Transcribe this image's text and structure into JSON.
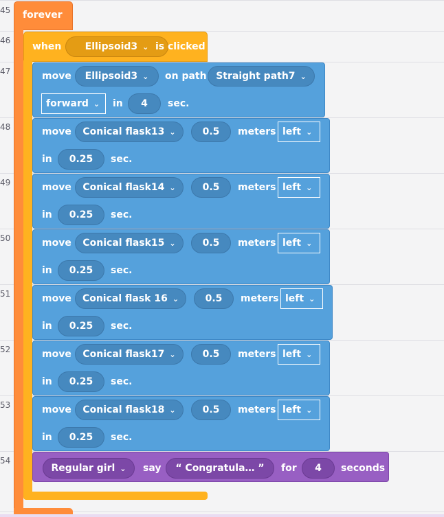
{
  "line_numbers": [
    "45",
    "46",
    "47",
    "48",
    "49",
    "50",
    "51",
    "52",
    "53",
    "54"
  ],
  "forever": {
    "label": "forever"
  },
  "event": {
    "when": "when",
    "object": "Ellipsoid3",
    "suffix": "is clicked"
  },
  "path_move": {
    "move": "move",
    "object": "Ellipsoid3",
    "on_path": "on path",
    "path": "Straight path7",
    "direction": "forward",
    "in": "in",
    "duration": "4",
    "unit": "sec."
  },
  "moves": [
    {
      "move": "move",
      "object": "Conical flask13",
      "distance": "0.5",
      "meters": "meters",
      "direction": "left",
      "in": "in",
      "duration": "0.25",
      "unit": "sec."
    },
    {
      "move": "move",
      "object": "Conical flask14",
      "distance": "0.5",
      "meters": "meters",
      "direction": "left",
      "in": "in",
      "duration": "0.25",
      "unit": "sec."
    },
    {
      "move": "move",
      "object": "Conical flask15",
      "distance": "0.5",
      "meters": "meters",
      "direction": "left",
      "in": "in",
      "duration": "0.25",
      "unit": "sec."
    },
    {
      "move": "move",
      "object": "Conical flask 16",
      "distance": "0.5",
      "meters": "meters",
      "direction": "left",
      "in": "in",
      "duration": "0.25",
      "unit": "sec."
    },
    {
      "move": "move",
      "object": "Conical flask17",
      "distance": "0.5",
      "meters": "meters",
      "direction": "left",
      "in": "in",
      "duration": "0.25",
      "unit": "sec."
    },
    {
      "move": "move",
      "object": "Conical flask18",
      "distance": "0.5",
      "meters": "meters",
      "direction": "left",
      "in": "in",
      "duration": "0.25",
      "unit": "sec."
    }
  ],
  "say": {
    "object": "Regular girl",
    "say": "say",
    "message": "“ Congratula… ”",
    "for": "for",
    "duration": "4",
    "unit": "seconds"
  },
  "icons": {
    "dropdown": "chevron-down-icon",
    "chevron_glyph": "⌄"
  },
  "colors": {
    "control": "#ff8c3a",
    "event": "#ffb21f",
    "motion": "#55a1dc",
    "looks": "#985fc3"
  }
}
